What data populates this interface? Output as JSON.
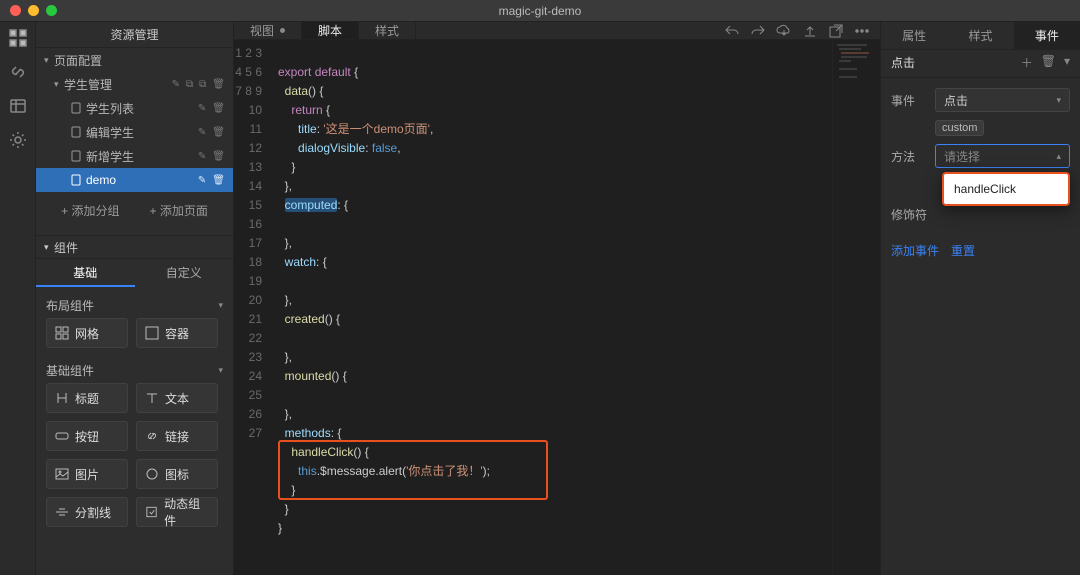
{
  "window": {
    "title": "magic-git-demo"
  },
  "leftPanel": {
    "title": "资源管理",
    "tree": {
      "root": {
        "label": "页面配置"
      },
      "group": {
        "label": "学生管理"
      },
      "items": [
        {
          "label": "学生列表"
        },
        {
          "label": "编辑学生"
        },
        {
          "label": "新增学生"
        },
        {
          "label": "demo",
          "selected": true
        }
      ]
    },
    "addGroup": "+ 添加分组",
    "addPage": "+ 添加页面",
    "componentsHeader": "组件",
    "componentTabs": {
      "base": "基础",
      "custom": "自定义"
    },
    "groupLayout": "布局组件",
    "groupBasic": "基础组件",
    "cards": {
      "grid": "网格",
      "container": "容器",
      "title": "标题",
      "text": "文本",
      "button": "按钮",
      "link": "链接",
      "image": "图片",
      "icon": "图标",
      "divider": "分割线",
      "dynamic": "动态组件"
    }
  },
  "editor": {
    "tabs": {
      "view": "视图",
      "script": "脚本",
      "style": "样式"
    },
    "code": {
      "line1": "",
      "kw_export": "export",
      "kw_default": "default",
      "fn_data": "data",
      "kw_return": "return",
      "prop_title": "title",
      "str_title": "'这是一个demo页面'",
      "prop_dialog": "dialogVisible",
      "bool_false": "false",
      "prop_computed": "computed",
      "prop_watch": "watch",
      "fn_created": "created",
      "fn_mounted": "mounted",
      "prop_methods": "methods",
      "fn_handleClick": "handleClick",
      "kw_this": "this",
      "method_chain": ".$message.alert(",
      "str_alert": "'你点击了我！'",
      "close_paren": ");"
    }
  },
  "rightPanel": {
    "tabs": {
      "props": "属性",
      "style": "样式",
      "events": "事件"
    },
    "clickHeader": "点击",
    "rows": {
      "eventLabel": "事件",
      "eventValue": "点击",
      "badge": "custom",
      "methodLabel": "方法",
      "methodPlaceholder": "请选择",
      "modifierLabel": "修饰符"
    },
    "dropdownOption": "handleClick",
    "addEvent": "添加事件",
    "reset": "重置"
  }
}
